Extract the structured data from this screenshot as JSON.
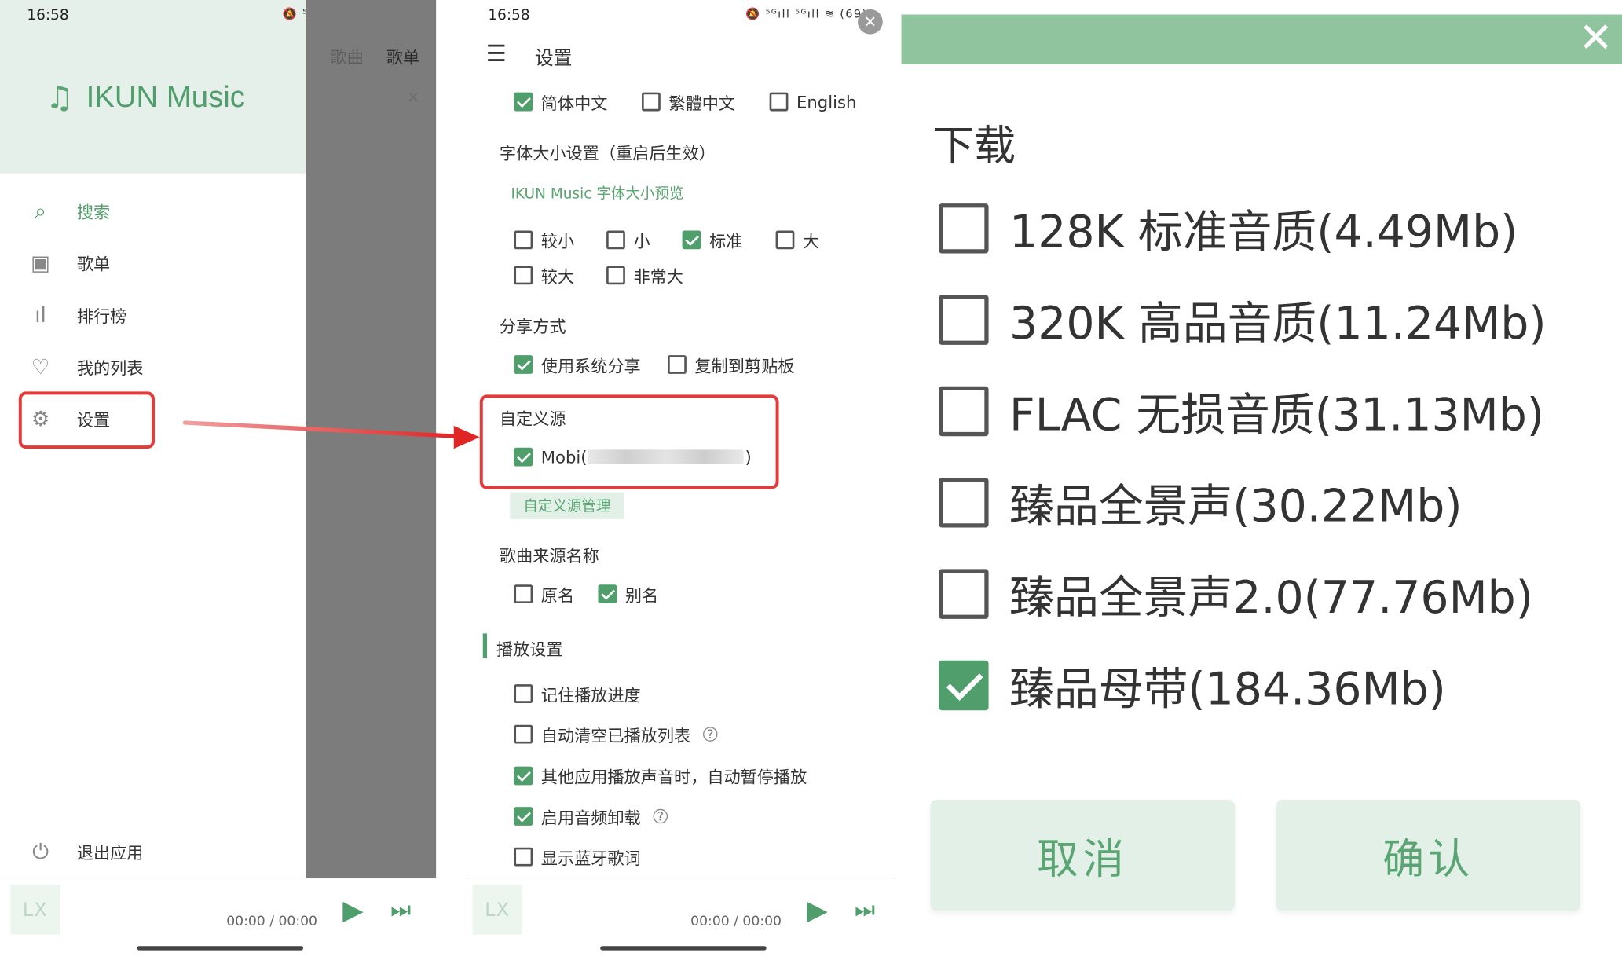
{
  "status": {
    "time": "16:58",
    "icons": "🔕 ⁵ᴳıll ⁵ᴳıll ≋ (69)"
  },
  "drawer": {
    "app_name": "IKUN Music",
    "items": [
      {
        "label": "搜索",
        "icon": "search-icon"
      },
      {
        "label": "歌单",
        "icon": "playlist-icon"
      },
      {
        "label": "排行榜",
        "icon": "chart-icon"
      },
      {
        "label": "我的列表",
        "icon": "heart-icon"
      },
      {
        "label": "设置",
        "icon": "gear-icon"
      }
    ],
    "exit_label": "退出应用",
    "dim_tabs": [
      "歌曲",
      "歌单"
    ]
  },
  "player": {
    "logo": "LX",
    "time": "00:00 / 00:00"
  },
  "settings": {
    "title": "设置",
    "lang": {
      "zh_cn": "简体中文",
      "zh_tw": "繁體中文",
      "en": "English"
    },
    "font_section": "字体大小设置（重启后生效）",
    "font_preview": "IKUN Music 字体大小预览",
    "font_sizes": {
      "smaller": "较小",
      "small": "小",
      "standard": "标准",
      "large": "大",
      "larger": "较大",
      "huge": "非常大"
    },
    "share_section": "分享方式",
    "share": {
      "system": "使用系统分享",
      "clipboard": "复制到剪贴板"
    },
    "custom_source_section": "自定义源",
    "custom_source": {
      "prefix": "Mobi(",
      "suffix": ")"
    },
    "custom_source_manage": "自定义源管理",
    "source_name_section": "歌曲来源名称",
    "source_name": {
      "original": "原名",
      "alias": "别名"
    },
    "play_section": "播放设置",
    "play": {
      "remember": "记住播放进度",
      "auto_clear": "自动清空已播放列表",
      "auto_pause": "其他应用播放声音时，自动暂停播放",
      "audio_offload": "启用音频卸载",
      "bluetooth_lyrics": "显示蓝牙歌词"
    },
    "help_glyph": "?"
  },
  "download": {
    "title": "下载",
    "options": [
      {
        "label": "128K 标准音质(4.49Mb)",
        "checked": false
      },
      {
        "label": "320K 高品音质(11.24Mb)",
        "checked": false
      },
      {
        "label": "FLAC 无损音质(31.13Mb)",
        "checked": false
      },
      {
        "label": "臻品全景声(30.22Mb)",
        "checked": false
      },
      {
        "label": "臻品全景声2.0(77.76Mb)",
        "checked": false
      },
      {
        "label": "臻品母带(184.36Mb)",
        "checked": true
      }
    ],
    "cancel": "取消",
    "confirm": "确认"
  },
  "colors": {
    "accent": "#4f9e6b",
    "dialog_bar": "#90c49f",
    "highlight": "#e33a3a"
  }
}
